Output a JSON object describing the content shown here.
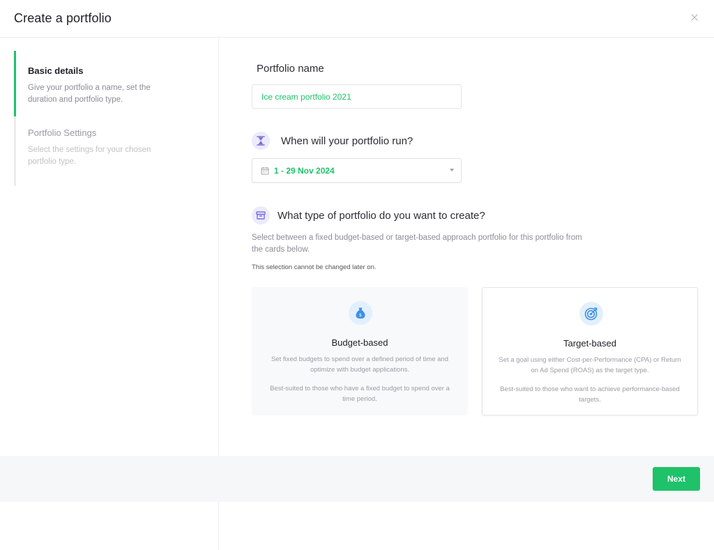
{
  "header": {
    "title": "Create a portfolio",
    "close_icon": "close-icon"
  },
  "sidebar": {
    "steps": [
      {
        "title": "Basic details",
        "description": "Give your portfolio a name, set the duration and portfolio type."
      },
      {
        "title": "Portfolio Settings",
        "description": "Select the settings for your chosen portfolio type."
      }
    ]
  },
  "form": {
    "portfolio_name_label": "Portfolio name",
    "portfolio_name_value": "Ice cream portfolio 2021",
    "run_label": "When will your portfolio run?",
    "date_range": "1 - 29 Nov 2024",
    "type_label": "What type of portfolio do you want to create?",
    "type_description": "Select between a fixed budget-based or target-based approach portfolio for this portfolio from the cards below.",
    "type_warning": "This selection cannot be changed later on."
  },
  "cards": {
    "budget": {
      "title": "Budget-based",
      "description": "Set fixed budgets to spend over a defined period of time and optimize with budget applications.",
      "suited": "Best-suited to those who have a fixed budget to spend over a time period."
    },
    "target": {
      "title": "Target-based",
      "description": "Set a goal using either Cost-per-Performance (CPA) or Return on Ad Spend (ROAS) as the target type.",
      "suited": "Best-suited to those who want to  achieve performance-based targets."
    }
  },
  "footer": {
    "next_label": "Next"
  },
  "colors": {
    "accent": "#1ec26a",
    "icon_bg_purple": "#ecebfb",
    "icon_bg_blue": "#e2f0fd"
  }
}
